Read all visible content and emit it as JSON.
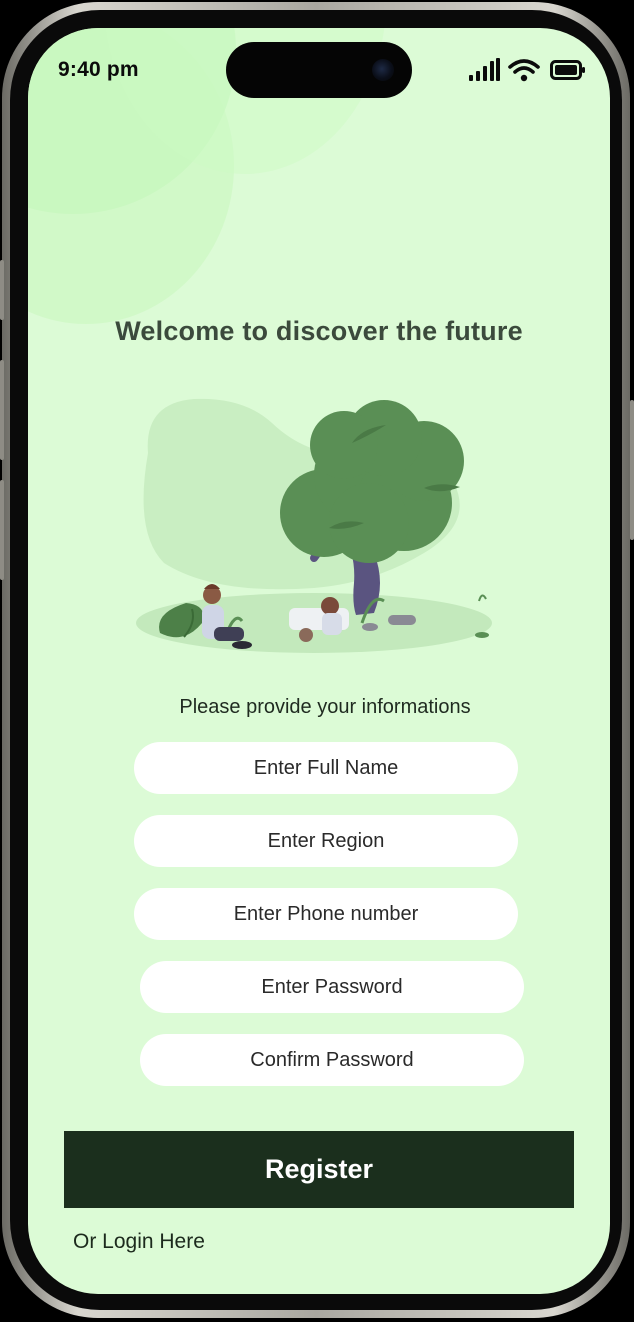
{
  "status_bar": {
    "time": "9:40 pm",
    "icons": [
      "signal-icon",
      "wifi-icon",
      "battery-icon"
    ]
  },
  "welcome": {
    "title": "Welcome to discover the future"
  },
  "illustration": {
    "icon": "tree-people-illustration"
  },
  "form": {
    "subtitle": "Please provide your informations",
    "full_name_placeholder": "Enter Full Name",
    "region_placeholder": "Enter Region",
    "phone_placeholder": "Enter Phone number",
    "password_placeholder": "Enter Password",
    "confirm_password_placeholder": "Confirm Password"
  },
  "actions": {
    "register_label": "Register",
    "login_label": "Or Login Here"
  },
  "colors": {
    "background": "#dcfbd6",
    "primary_button": "#1b2f1d",
    "title_text": "#3b4a3c",
    "field_background": "#ffffff",
    "tree_foliage": "#5a8f55"
  }
}
